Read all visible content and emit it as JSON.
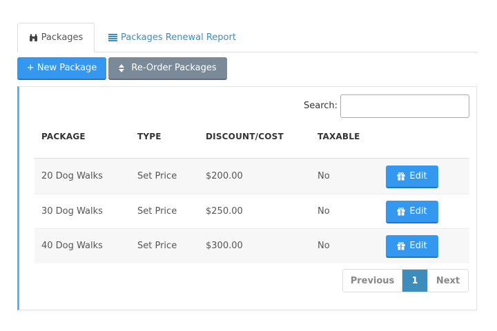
{
  "tabs": [
    {
      "label": "Packages",
      "icon": "binoculars-icon",
      "active": true
    },
    {
      "label": "Packages Renewal Report",
      "icon": "list-icon",
      "active": false
    }
  ],
  "toolbar": {
    "new_label": "+ New Package",
    "reorder_label": "Re-Order Packages",
    "reorder_icon": "sort-icon"
  },
  "search": {
    "label": "Search:",
    "value": "",
    "placeholder": ""
  },
  "table": {
    "headers": {
      "package": "PACKAGE",
      "type": "TYPE",
      "cost": "DISCOUNT/COST",
      "taxable": "TAXABLE"
    },
    "rows": [
      {
        "package": "20 Dog Walks",
        "type": "Set Price",
        "cost": "$200.00",
        "taxable": "No",
        "action": "Edit"
      },
      {
        "package": "30 Dog Walks",
        "type": "Set Price",
        "cost": "$250.00",
        "taxable": "No",
        "action": "Edit"
      },
      {
        "package": "40 Dog Walks",
        "type": "Set Price",
        "cost": "$300.00",
        "taxable": "No",
        "action": "Edit"
      }
    ]
  },
  "pagination": {
    "previous": "Previous",
    "current": "1",
    "next": "Next"
  },
  "colors": {
    "primary": "#3598f0",
    "secondary": "#7b8a99",
    "accent": "#4fb6e6",
    "link": "#3c8dbc"
  }
}
